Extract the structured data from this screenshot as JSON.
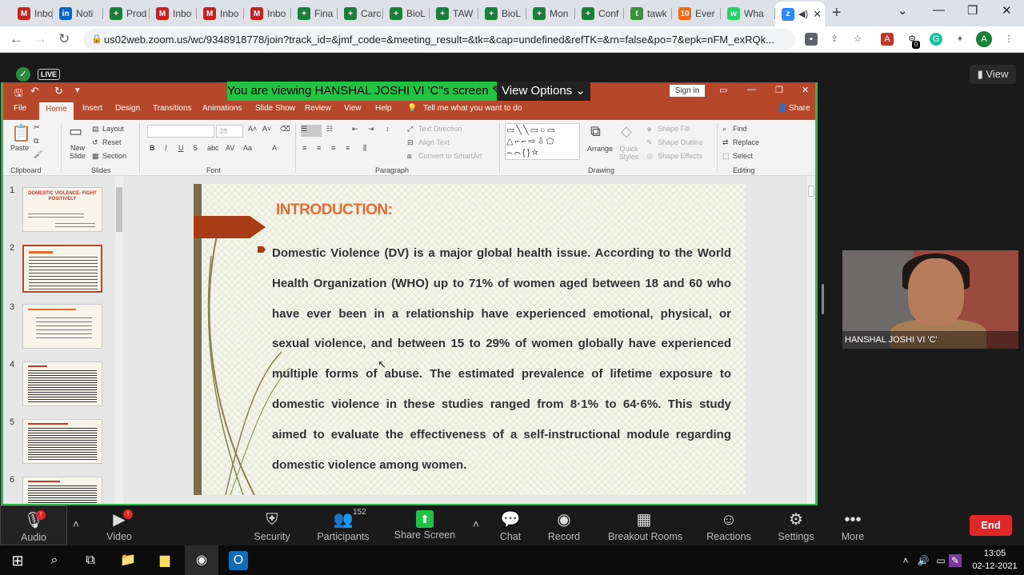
{
  "browser": {
    "tabs": [
      {
        "label": "Inbo",
        "icon": "gmail-icon",
        "color": "#c5221f",
        "glyph": "M"
      },
      {
        "label": "Noti",
        "icon": "linkedin-icon",
        "color": "#0a66c2",
        "glyph": "in"
      },
      {
        "label": "Prod",
        "icon": "sheets-icon",
        "color": "#188038",
        "glyph": "+"
      },
      {
        "label": "Inbo",
        "icon": "gmail-icon",
        "color": "#c5221f",
        "glyph": "M"
      },
      {
        "label": "Inbo",
        "icon": "gmail-icon",
        "color": "#c5221f",
        "glyph": "M"
      },
      {
        "label": "Inbo",
        "icon": "gmail-icon",
        "color": "#c5221f",
        "glyph": "M"
      },
      {
        "label": "Fina",
        "icon": "sheets-icon",
        "color": "#188038",
        "glyph": "+"
      },
      {
        "label": "Carc",
        "icon": "sheets-icon",
        "color": "#188038",
        "glyph": "+"
      },
      {
        "label": "BioL",
        "icon": "sheets-icon",
        "color": "#188038",
        "glyph": "+"
      },
      {
        "label": "TAW",
        "icon": "sheets-icon",
        "color": "#188038",
        "glyph": "+"
      },
      {
        "label": "BioL",
        "icon": "sheets-icon",
        "color": "#188038",
        "glyph": "+"
      },
      {
        "label": "Mon",
        "icon": "sheets-icon",
        "color": "#188038",
        "glyph": "+"
      },
      {
        "label": "Conf",
        "icon": "sheets-icon",
        "color": "#188038",
        "glyph": "+"
      },
      {
        "label": "tawk",
        "icon": "tawk-icon",
        "color": "#3b8f3b",
        "glyph": "t"
      },
      {
        "label": "Ever",
        "icon": "ten-icon",
        "color": "#f06a1d",
        "glyph": "10"
      },
      {
        "label": "Wha",
        "icon": "whatsapp-icon",
        "color": "#25d366",
        "glyph": "w"
      },
      {
        "label": "",
        "icon": "zoom-icon",
        "color": "#2d8cff",
        "glyph": "z",
        "active": true
      }
    ],
    "new_tab": "+",
    "url": "us02web.zoom.us/wc/9348918778/join?track_id=&jmf_code=&meeting_result=&tk=&cap=undefined&refTK=&rn=false&po=7&epk=nFM_exRQk...",
    "profile_initial": "A",
    "ext_badge": "0"
  },
  "zoom": {
    "live_label": "LIVE",
    "view_label": "View",
    "share_banner": "You are viewing HANSHAL JOSHI VI 'C''s screen",
    "view_options": "View Options",
    "participant_name": "HANSHAL JOSHI VI 'C'",
    "toolbar": {
      "audio": "Audio",
      "video": "Video",
      "security": "Security",
      "participants": "Participants",
      "participants_count": "152",
      "share_screen": "Share Screen",
      "chat": "Chat",
      "record": "Record",
      "breakout": "Breakout Rooms",
      "reactions": "Reactions",
      "settings": "Settings",
      "more": "More",
      "end": "End",
      "audio_badge": "!",
      "video_badge": "!"
    }
  },
  "ppt": {
    "sign_in": "Sign in",
    "tabs": [
      "File",
      "Home",
      "Insert",
      "Design",
      "Transitions",
      "Animations",
      "Slide Show",
      "Review",
      "View",
      "Help"
    ],
    "tell_me": "Tell me what you want to do",
    "share": "Share",
    "ribbon": {
      "paste": "Paste",
      "new_slide": "New Slide",
      "layout": "Layout",
      "reset": "Reset",
      "section": "Section",
      "font_size": "28",
      "text_direction": "Text Direction",
      "align_text": "Align Text",
      "convert_smartart": "Convert to SmartArt",
      "arrange": "Arrange",
      "quick_styles": "Quick Styles",
      "shape_fill": "Shape Fill",
      "shape_outline": "Shape Outline",
      "shape_effects": "Shape Effects",
      "find": "Find",
      "replace": "Replace",
      "select": "Select",
      "groups": {
        "clipboard": "Clipboard",
        "slides": "Slides",
        "font": "Font",
        "paragraph": "Paragraph",
        "drawing": "Drawing",
        "editing": "Editing"
      }
    },
    "thumbnails": [
      "1",
      "2",
      "3",
      "4",
      "5",
      "6"
    ],
    "thumb1_title": "DOMESTIC VIOLENCE- FIGHT POSITIVELY",
    "slide": {
      "title": "INTRODUCTION:",
      "body": "Domestic Violence (DV) is a major global health issue. According to the World Health Organization (WHO) up to 71% of women aged between 18 and 60 who have ever been in a relationship have experienced emotional, physical, or sexual violence, and between 15 to 29% of women globally have experienced multiple forms of abuse. The estimated prevalence of lifetime exposure to domestic violence in these studies ranged from 8·1% to 64·6%. This study aimed to evaluate the effectiveness of a self-instructional module regarding domestic violence among women."
    }
  },
  "taskbar": {
    "time": "13:05",
    "date": "02-12-2021"
  },
  "colors": {
    "ppt_accent": "#b7472a",
    "zoom_green": "#22c244",
    "end_red": "#e02828"
  }
}
